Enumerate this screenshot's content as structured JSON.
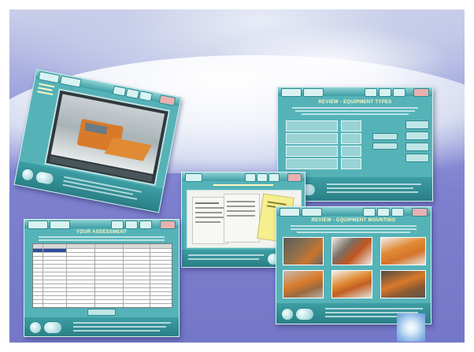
{
  "background": {
    "theme": "snowy-hill",
    "colors": {
      "sky": "#c9cfe9",
      "hill": "#ffffff",
      "base": "#7477c7"
    }
  },
  "screens": [
    {
      "id": "video",
      "sidebar_label": "",
      "description": "snowplow-video-player"
    },
    {
      "id": "equipment-types",
      "title": "REVIEW - EQUIPMENT TYPES",
      "option_buttons": [
        "",
        "",
        ""
      ],
      "right_buttons": [
        "",
        "",
        "",
        ""
      ]
    },
    {
      "id": "employment-docs",
      "title": "",
      "description": "documents-and-manual"
    },
    {
      "id": "self-assessment",
      "title": "YOUR ASSESSMENT",
      "table_headers": [
        "",
        "",
        "",
        "",
        ""
      ],
      "table_rows": [
        "",
        "",
        "",
        "",
        "",
        "",
        "",
        "",
        "",
        "",
        "",
        "",
        "",
        ""
      ],
      "footer_button": ""
    },
    {
      "id": "equipment-mounting",
      "title": "REVIEW - EQUIPMENT MOUNTING"
    }
  ],
  "corner_ornament": "snowflake-tile"
}
